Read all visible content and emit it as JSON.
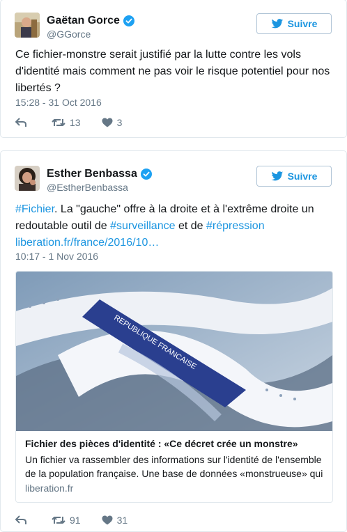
{
  "tweets": [
    {
      "display_name": "Gaëtan Gorce",
      "handle": "@GGorce",
      "follow_label": "Suivre",
      "text": "Ce fichier-monstre serait justifié par la lutte contre les vols d'identité mais comment ne pas voir le risque potentiel pour nos libertés ?",
      "timestamp": "15:28 - 31 Oct 2016",
      "retweets": "13",
      "likes": "3"
    },
    {
      "display_name": "Esther Benbassa",
      "handle": "@EstherBenbassa",
      "follow_label": "Suivre",
      "text": {
        "hashtag1": "#Fichier",
        "part1": ". La \"gauche\" offre à la droite et à l'extrême droite un redoutable outil de ",
        "hashtag2": "#surveillance",
        "part2": " et de ",
        "hashtag3": "#répression",
        "link": "liberation.fr/france/2016/10…"
      },
      "timestamp": "10:17 - 1 Nov 2016",
      "card": {
        "title": "Fichier des pièces d'identité : «Ce décret crée un monstre»",
        "description": "Un fichier va rassembler des informations sur l'identité de l'ensemble de la population française. Une base de données «monstrueuse» qui",
        "domain": "liberation.fr",
        "image_text": "REPUBLIQUE FRANCAISE"
      },
      "retweets": "91",
      "likes": "31"
    }
  ],
  "colors": {
    "accent": "#1b95e0",
    "text": "#14171a",
    "muted": "#657786",
    "border": "#e1e8ed"
  }
}
